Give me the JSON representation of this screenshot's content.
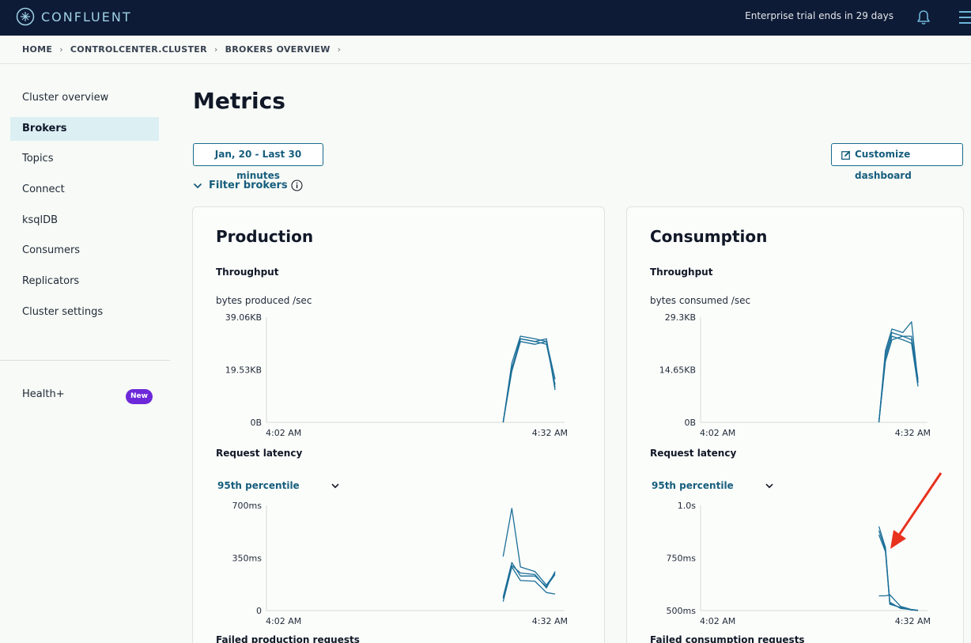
{
  "header": {
    "brand": "CONFLUENT",
    "trial_text": "Enterprise trial ends in 29 days"
  },
  "breadcrumb": [
    "HOME",
    "CONTROLCENTER.CLUSTER",
    "BROKERS OVERVIEW"
  ],
  "sidebar": {
    "items": [
      {
        "label": "Cluster overview"
      },
      {
        "label": "Brokers",
        "active": true
      },
      {
        "label": "Topics"
      },
      {
        "label": "Connect"
      },
      {
        "label": "ksqlDB"
      },
      {
        "label": "Consumers"
      },
      {
        "label": "Replicators"
      },
      {
        "label": "Cluster settings"
      }
    ],
    "health": {
      "label": "Health+",
      "badge": "New"
    }
  },
  "main": {
    "title": "Metrics",
    "date_range": "Jan, 20 - Last 30 minutes",
    "customize_label": "Customize dashboard",
    "filter_label": "Filter brokers"
  },
  "production": {
    "title": "Production",
    "throughput_label": "Throughput",
    "throughput_metric": "bytes produced /sec",
    "latency_label": "Request latency",
    "percentile": "95th percentile",
    "failed_label": "Failed production requests"
  },
  "consumption": {
    "title": "Consumption",
    "throughput_label": "Throughput",
    "throughput_metric": "bytes consumed /sec",
    "latency_label": "Request latency",
    "percentile": "95th percentile",
    "failed_label": "Failed consumption requests"
  },
  "colors": {
    "series": "#1c6f99",
    "accent": "#165d7d",
    "arrow": "#e8321e"
  },
  "chart_data": [
    {
      "id": "prod-throughput",
      "type": "line",
      "ylabel": "bytes produced /sec",
      "x_ticks": [
        "4:02 AM",
        "4:32 AM"
      ],
      "y_ticks": [
        "39.06KB",
        "19.53KB",
        "0B"
      ],
      "ylim": [
        0,
        39.06
      ],
      "x": [
        0.82,
        0.85,
        0.88,
        0.93,
        0.97,
        1.0
      ],
      "series": [
        {
          "values": [
            0,
            22,
            32,
            31,
            30,
            16
          ]
        },
        {
          "values": [
            0,
            20,
            31,
            30,
            29,
            14
          ]
        },
        {
          "values": [
            0,
            19,
            30,
            29,
            30,
            13
          ]
        },
        {
          "values": [
            0,
            20,
            31,
            30,
            31,
            12
          ]
        }
      ]
    },
    {
      "id": "prod-latency",
      "type": "line",
      "ylabel": "Request latency",
      "x_ticks": [
        "4:02 AM",
        "4:32 AM"
      ],
      "y_ticks": [
        "700ms",
        "350ms",
        "0"
      ],
      "ylim": [
        0,
        700
      ],
      "x": [
        0.82,
        0.85,
        0.88,
        0.93,
        0.97,
        1.0
      ],
      "series": [
        {
          "values": [
            360,
            680,
            290,
            260,
            170,
            250
          ]
        },
        {
          "values": [
            80,
            300,
            250,
            240,
            150,
            260
          ]
        },
        {
          "values": [
            60,
            290,
            200,
            195,
            120,
            110
          ]
        },
        {
          "values": [
            90,
            320,
            230,
            230,
            160,
            240
          ]
        }
      ]
    },
    {
      "id": "cons-throughput",
      "type": "line",
      "ylabel": "bytes consumed /sec",
      "x_ticks": [
        "4:02 AM",
        "4:32 AM"
      ],
      "y_ticks": [
        "29.3KB",
        "14.65KB",
        "0B"
      ],
      "ylim": [
        0,
        29.3
      ],
      "x": [
        0.82,
        0.85,
        0.88,
        0.93,
        0.97,
        1.0
      ],
      "series": [
        {
          "values": [
            0,
            20,
            26,
            25,
            28,
            11
          ]
        },
        {
          "values": [
            0,
            18,
            24,
            23,
            22,
            10
          ]
        },
        {
          "values": [
            0,
            17,
            23,
            24,
            24,
            12
          ]
        },
        {
          "values": [
            0,
            19,
            25,
            24,
            23,
            11
          ]
        }
      ]
    },
    {
      "id": "cons-latency",
      "type": "line",
      "ylabel": "Request latency",
      "x_ticks": [
        "4:02 AM",
        "4:32 AM"
      ],
      "y_ticks": [
        "1.0s",
        "750ms",
        "500ms"
      ],
      "ylim": [
        500,
        1000
      ],
      "x": [
        0.82,
        0.85,
        0.87,
        0.92,
        0.97,
        1.0
      ],
      "series": [
        {
          "values": [
            900,
            800,
            540,
            510,
            505,
            500
          ]
        },
        {
          "values": [
            880,
            790,
            530,
            515,
            503,
            501
          ]
        },
        {
          "values": [
            570,
            570,
            575,
            520,
            505,
            502
          ]
        },
        {
          "values": [
            860,
            780,
            535,
            512,
            504,
            500
          ]
        }
      ]
    }
  ]
}
